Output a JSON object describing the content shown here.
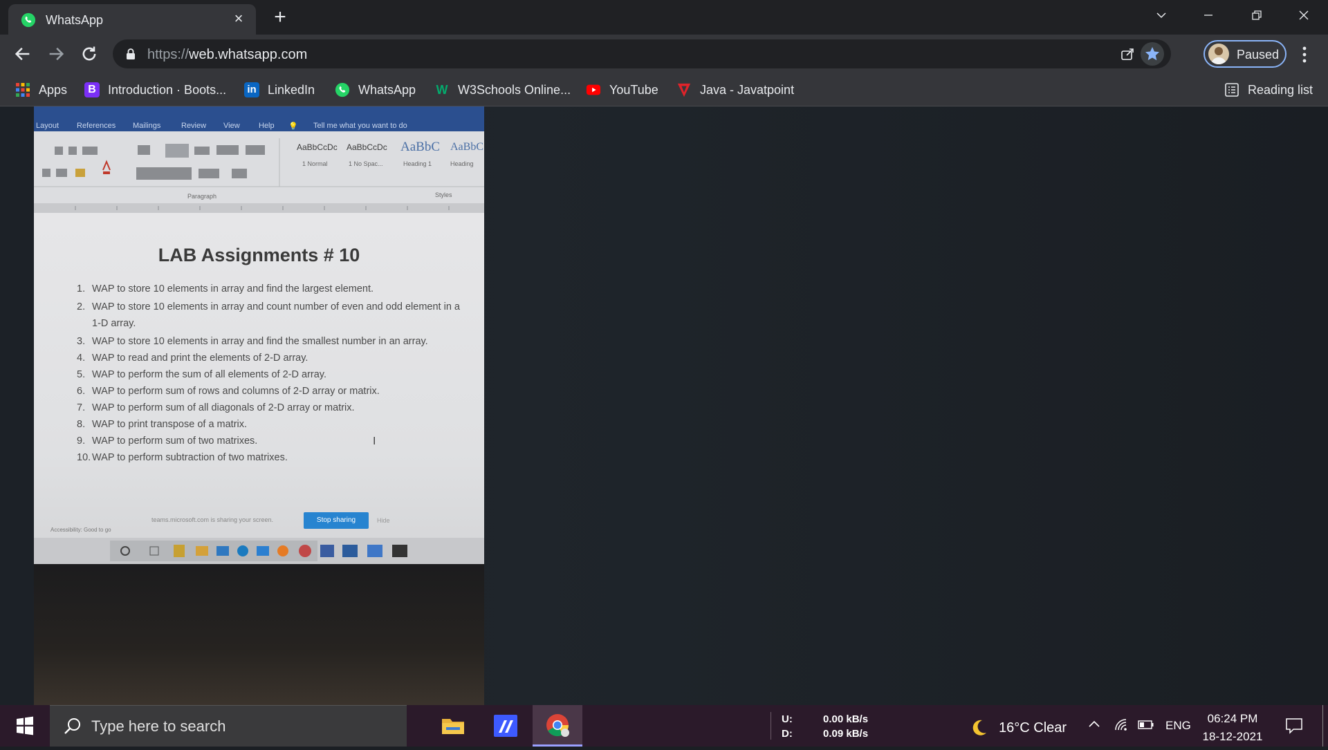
{
  "browser": {
    "tab": {
      "title": "WhatsApp",
      "favicon": "whatsapp-icon"
    },
    "url": {
      "scheme": "https://",
      "host": "web.whatsapp.com"
    },
    "profile": {
      "label": "Paused"
    },
    "bookmarks": [
      {
        "label": "Apps",
        "icon": "apps-grid-icon"
      },
      {
        "label": "Introduction · Boots...",
        "icon": "bootstrap-icon"
      },
      {
        "label": "LinkedIn",
        "icon": "linkedin-icon"
      },
      {
        "label": "WhatsApp",
        "icon": "whatsapp-icon"
      },
      {
        "label": "W3Schools Online...",
        "icon": "w3schools-icon"
      },
      {
        "label": "YouTube",
        "icon": "youtube-icon"
      },
      {
        "label": "Java - Javatpoint",
        "icon": "javatpoint-icon"
      }
    ],
    "reading_list": "Reading list"
  },
  "photo": {
    "ribbon_tabs": [
      "Layout",
      "References",
      "Mailings",
      "Review",
      "View",
      "Help",
      "Tell me what you want to do"
    ],
    "ribbon_styles": [
      "AaBbCcDc",
      "AaBbCcDc",
      "AaBbC",
      "AaBbC"
    ],
    "ribbon_style_names": [
      "1 Normal",
      "1 No Spac...",
      "Heading 1",
      "Heading"
    ],
    "ribbon_groups": [
      "Paragraph",
      "Styles"
    ],
    "title": "LAB Assignments # 10",
    "items": [
      {
        "n": "1.",
        "text": "WAP to store 10 elements in array and find the largest element."
      },
      {
        "n": "2.",
        "text": "WAP to store 10 elements in array and count number of even and odd element in a 1-D array."
      },
      {
        "n": "3.",
        "text": "WAP to store 10 elements in array and find the smallest number in an array."
      },
      {
        "n": "4.",
        "text": "WAP to read and print the elements of 2-D array."
      },
      {
        "n": "5.",
        "text": "WAP to perform the sum of all elements of 2-D array."
      },
      {
        "n": "6.",
        "text": "WAP to perform sum of rows and columns of 2-D array or matrix."
      },
      {
        "n": "7.",
        "text": "WAP to perform sum of all diagonals of 2-D array or matrix."
      },
      {
        "n": "8.",
        "text": "WAP to print transpose of a matrix."
      },
      {
        "n": "9.",
        "text": "WAP to perform sum of two matrixes."
      },
      {
        "n": "10.",
        "text": "WAP to perform subtraction of two matrixes."
      }
    ],
    "sharing_message": "teams.microsoft.com is sharing your screen.",
    "stop_sharing": "Stop sharing",
    "hide": "Hide",
    "accessibility": "Accessibility: Good to go"
  },
  "taskbar": {
    "search_placeholder": "Type here to search",
    "net": {
      "u_label": "U:",
      "u_value": "0.00 kB/s",
      "d_label": "D:",
      "d_value": "0.09 kB/s"
    },
    "weather": "16°C  Clear",
    "language": "ENG",
    "time": "06:24 PM",
    "date": "18-12-2021"
  },
  "colors": {
    "chrome_dark": "#202124",
    "chrome_toolbar": "#35363a",
    "accent_blue": "#8ab4f8",
    "taskbar": "#2b1a2a"
  }
}
